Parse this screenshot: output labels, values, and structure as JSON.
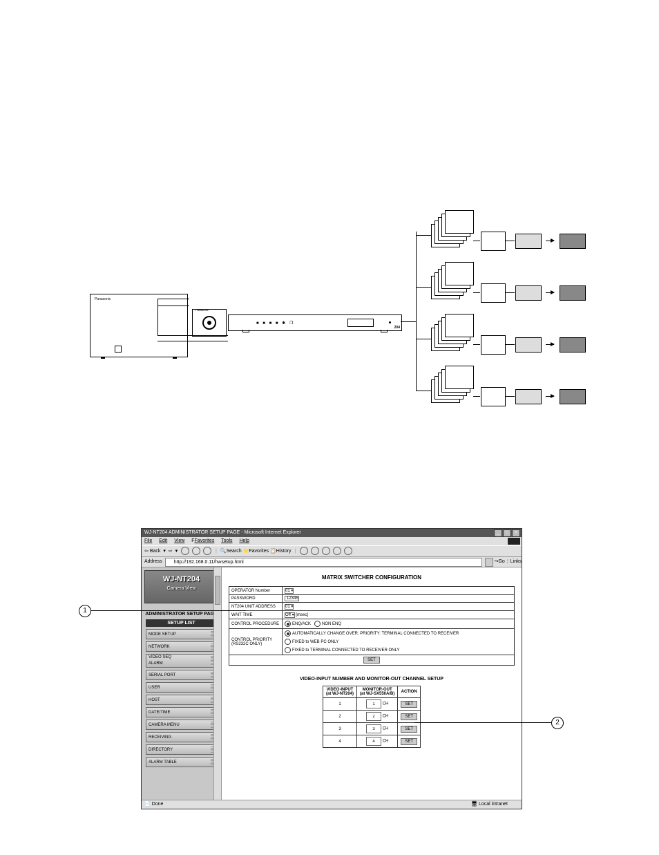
{
  "browser": {
    "title": "WJ-NT204 ADMINISTRATOR SETUP PAGE - Microsoft Internet Explorer",
    "menu": {
      "file": "File",
      "edit": "Edit",
      "view": "View",
      "fav": "Favorites",
      "tools": "Tools",
      "help": "Help"
    },
    "toolbar": {
      "back": "Back",
      "search": "Search",
      "favorites": "Favorites",
      "history": "History"
    },
    "address_label": "Address",
    "url": "http://192.168.0.11/hwsetup.html",
    "go": "Go",
    "links": "Links",
    "status": "Done",
    "zone": "Local intranet"
  },
  "sidebar": {
    "logo": "WJ-NT204",
    "logo_sub": "Camera View",
    "admin_hdr": "ADMINISTRATOR SETUP PAGE",
    "setup_list": "SETUP LIST",
    "items": [
      "MODE SETUP",
      "NETWORK",
      "VIDEO SEQ\nALARM",
      "SERIAL PORT",
      "USER",
      "HOST",
      "DATE/TIME",
      "CAMERA MENU",
      "RECEIVING",
      "DIRECTORY",
      "ALARM TABLE"
    ]
  },
  "main": {
    "title": "MATRIX SWITCHER CONFIGURATION",
    "rows": {
      "op_num_lbl": "OPERATOR Number",
      "op_num_val": "01",
      "pwd_lbl": "PASSWORD",
      "pwd_val": "12345",
      "addr_lbl": "NT204 UNIT ADDRESS",
      "addr_val": "01",
      "wait_lbl": "WAIT TIME",
      "wait_val": "Off",
      "wait_unit": "[msec]",
      "proc_lbl": "CONTROL PROCEDURE",
      "proc_a": "ENQ/ACK",
      "proc_b": "NON ENQ",
      "prio_lbl": "CONTROL PRIORITY\n(RS232C ONLY)",
      "prio_a": "AUTOMATICALLY CHANGE OVER, PRIORITY: TERMINAL CONNECTED TO RECEIVER",
      "prio_b": "FIXED to WEB PC ONLY",
      "prio_c": "FIXED to TERMINAL CONNECTED TO RECEIVER ONLY",
      "set_btn": "SET"
    },
    "subtitle": "VIDEO-INPUT NUMBER AND MONITOR-OUT CHANNEL SETUP",
    "ch_head": {
      "a": "VIDEO-INPUT\n(at WJ-NT204)",
      "b": "MONITOR-OUT\n(at WJ-SX550A/B)",
      "c": "ACTION"
    },
    "ch_rows": [
      {
        "in": "1",
        "out": "1",
        "btn": "SET"
      },
      {
        "in": "2",
        "out": "2",
        "btn": "SET"
      },
      {
        "in": "3",
        "out": "3",
        "btn": "SET"
      },
      {
        "in": "4",
        "out": "4",
        "btn": "SET"
      }
    ],
    "ch_suffix": "CH"
  },
  "callouts": {
    "one": "1",
    "two": "2"
  },
  "diagram": {
    "rack_num": "204"
  }
}
